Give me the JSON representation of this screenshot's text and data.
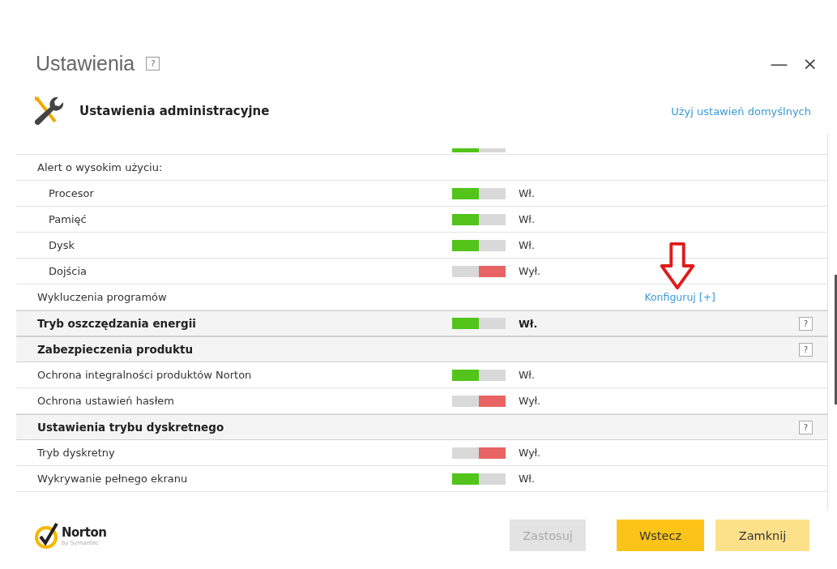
{
  "window": {
    "title": "Ustawienia",
    "help": "?",
    "minimize": "—",
    "close": "×"
  },
  "header": {
    "title": "Ustawienia administracyjne",
    "link": "Użyj ustawień domyślnych"
  },
  "rows": [
    {
      "kind": "cut",
      "toggle": {
        "on": true
      }
    },
    {
      "kind": "item",
      "label": "Alert o wysokim użyciu:",
      "children": [
        {
          "kind": "item",
          "label": "Procesor",
          "toggle": {
            "on": true,
            "status": "Wł."
          }
        },
        {
          "kind": "item",
          "label": "Pamięć",
          "toggle": {
            "on": true,
            "status": "Wł."
          }
        },
        {
          "kind": "item",
          "label": "Dysk",
          "toggle": {
            "on": true,
            "status": "Wł."
          }
        },
        {
          "kind": "item",
          "label": "Dojścia",
          "toggle": {
            "on": false,
            "status": "Wył."
          }
        }
      ]
    },
    {
      "kind": "item",
      "label": "Wykluczenia programów",
      "link": "Konfiguruj [+]"
    },
    {
      "kind": "section",
      "label": "Tryb oszczędzania energii",
      "toggle": {
        "on": true,
        "status": "Wł."
      },
      "help": "?"
    },
    {
      "kind": "section",
      "label": "Zabezpieczenia produktu",
      "help": "?",
      "children": [
        {
          "kind": "item",
          "label": "Ochrona integralności produktów Norton",
          "toggle": {
            "on": true,
            "status": "Wł."
          }
        },
        {
          "kind": "item",
          "label": "Ochrona ustawień hasłem",
          "toggle": {
            "on": false,
            "status": "Wył."
          }
        }
      ]
    },
    {
      "kind": "section",
      "label": "Ustawienia trybu dyskretnego",
      "help": "?",
      "children": [
        {
          "kind": "item",
          "label": "Tryb dyskretny",
          "toggle": {
            "on": false,
            "status": "Wył."
          }
        },
        {
          "kind": "item",
          "label": "Wykrywanie pełnego ekranu",
          "toggle": {
            "on": true,
            "status": "Wł."
          }
        }
      ]
    }
  ],
  "logo": {
    "name": "Norton",
    "sub": "by Symantec"
  },
  "buttons": [
    {
      "label": "Zastosuj",
      "kind": "disabled"
    },
    {
      "label": "Wstecz",
      "kind": "primary"
    },
    {
      "label": "Zamknij",
      "kind": "secondary"
    }
  ]
}
